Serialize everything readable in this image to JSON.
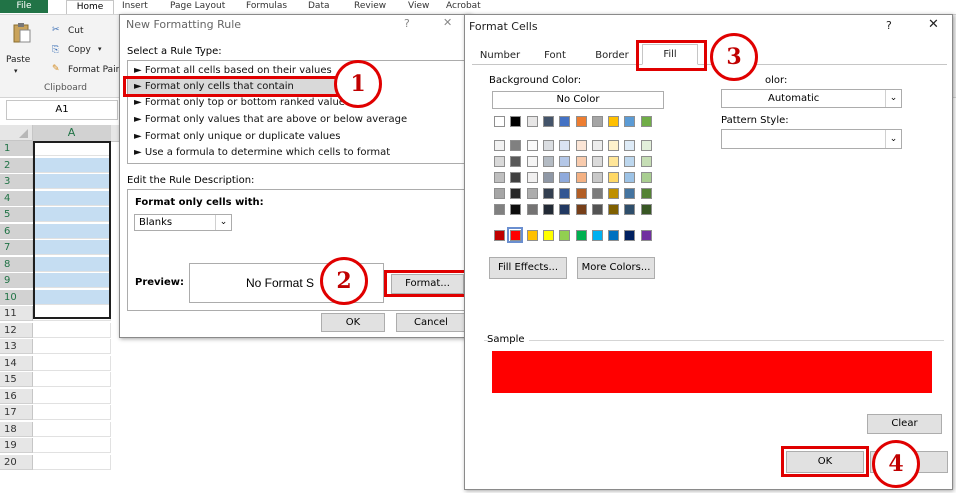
{
  "ribbon": {
    "tabs": [
      "File",
      "Home",
      "Insert",
      "Page Layout",
      "Formulas",
      "Data",
      "Review",
      "View",
      "Acrobat"
    ],
    "cut": "Cut",
    "copy": "Copy",
    "paste": "Paste",
    "format_painter": "Format Pain",
    "clipboard_group": "Clipboard"
  },
  "sheet": {
    "name_box": "A1",
    "selected_column": "A",
    "rows": [
      "1",
      "2",
      "3",
      "4",
      "5",
      "6",
      "7",
      "8",
      "9",
      "10",
      "11",
      "12",
      "13",
      "14",
      "15",
      "16",
      "17",
      "18",
      "19",
      "20"
    ]
  },
  "new_rule_dialog": {
    "title": "New Formatting Rule",
    "help": "?",
    "close": "✕",
    "select_type_label": "Select a Rule Type:",
    "rule_types": [
      "► Format all cells based on their values",
      "► Format only cells that contain",
      "► Format only top or bottom ranked values",
      "► Format only values that are above or below average",
      "► Format only unique or duplicate values",
      "► Use a formula to determine which cells to format"
    ],
    "edit_label": "Edit the Rule Description:",
    "format_only_label": "Format only cells with:",
    "condition_value": "Blanks",
    "preview_label": "Preview:",
    "preview_text": "No Format S",
    "format_button": "Format...",
    "ok": "OK",
    "cancel": "Cancel"
  },
  "format_cells_dialog": {
    "title": "Format Cells",
    "help": "?",
    "close": "✕",
    "tabs": [
      "Number",
      "Font",
      "Border",
      "Fill"
    ],
    "active_tab": "Fill",
    "background_color_label": "Background Color:",
    "no_color": "No Color",
    "pattern_color_label": "olor:",
    "pattern_color_value": "Automatic",
    "pattern_style_label": "Pattern Style:",
    "pattern_style_value": "",
    "fill_effects": "Fill Effects...",
    "more_colors": "More Colors...",
    "sample_label": "Sample",
    "sample_color": "#ff0000",
    "clear": "Clear",
    "ok": "OK"
  },
  "palette": {
    "theme_top": [
      "#ffffff",
      "#000000",
      "#e7e6e6",
      "#44546a",
      "#4472c4",
      "#ed7d31",
      "#a5a5a5",
      "#ffc000",
      "#5b9bd5",
      "#70ad47"
    ],
    "standard": [
      "#c00000",
      "#ff0000",
      "#ffc000",
      "#ffff00",
      "#92d050",
      "#00b050",
      "#00b0f0",
      "#0070c0",
      "#002060",
      "#7030a0"
    ],
    "selected_standard_index": 1
  },
  "annotations": {
    "step1": "1",
    "step2": "2",
    "step3": "3",
    "step4": "4",
    "highlight_color": "#e00000"
  }
}
